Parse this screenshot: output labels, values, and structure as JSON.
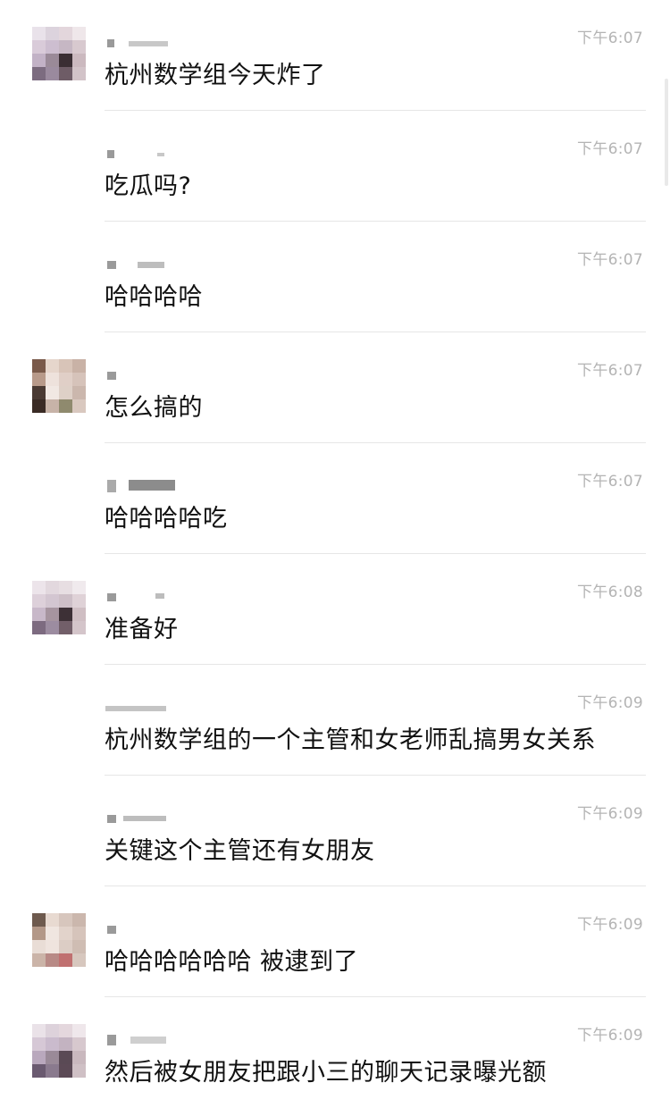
{
  "messages": [
    {
      "time": "下午6:07",
      "text": "杭州数学组今天炸了",
      "has_avatar": true
    },
    {
      "time": "下午6:07",
      "text": "吃瓜吗?",
      "has_avatar": false
    },
    {
      "time": "下午6:07",
      "text": "哈哈哈哈",
      "has_avatar": false
    },
    {
      "time": "下午6:07",
      "text": "怎么搞的",
      "has_avatar": true
    },
    {
      "time": "下午6:07",
      "text": "哈哈哈哈吃",
      "has_avatar": false
    },
    {
      "time": "下午6:08",
      "text": "准备好",
      "has_avatar": true
    },
    {
      "time": "下午6:09",
      "text": "杭州数学组的一个主管和女老师乱搞男女关系",
      "has_avatar": false
    },
    {
      "time": "下午6:09",
      "text": "关键这个主管还有女朋友",
      "has_avatar": false
    },
    {
      "time": "下午6:09",
      "text": "哈哈哈哈哈哈 被逮到了",
      "has_avatar": true
    },
    {
      "time": "下午6:09",
      "text": "然后被女朋友把跟小三的聊天记录曝光额",
      "has_avatar": true
    }
  ],
  "colors": {
    "text": "#111111",
    "time": "#b4b4b4",
    "divider": "#e6e6e6",
    "background": "#ffffff"
  }
}
